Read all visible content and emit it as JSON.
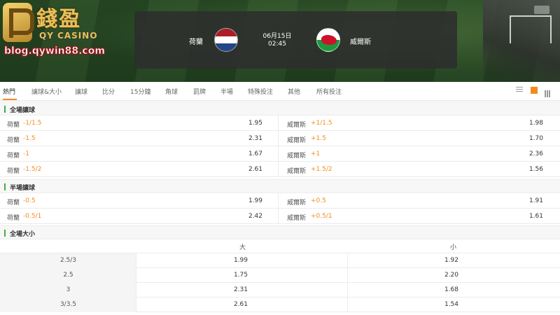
{
  "logo": {
    "brand_cn": "錢盈",
    "brand_en": "QY CASINO",
    "url": "blog.qywin88.com"
  },
  "match": {
    "home_team": "荷蘭",
    "away_team": "威爾斯",
    "date": "06月15日",
    "time": "02:45"
  },
  "tabs": [
    {
      "label": "熱門"
    },
    {
      "label": "讓球&大小"
    },
    {
      "label": "讓球"
    },
    {
      "label": "比分"
    },
    {
      "label": "15分鐘"
    },
    {
      "label": "角球"
    },
    {
      "label": "罰牌"
    },
    {
      "label": "半場"
    },
    {
      "label": "特殊投注"
    },
    {
      "label": "其他"
    },
    {
      "label": "所有投注"
    }
  ],
  "sections": {
    "full_handicap": {
      "title": "全場讓球",
      "rows": [
        {
          "home": "荷蘭",
          "home_hcp": "-1/1.5",
          "home_odds": "1.95",
          "away": "威爾斯",
          "away_hcp": "+1/1.5",
          "away_odds": "1.98"
        },
        {
          "home": "荷蘭",
          "home_hcp": "-1.5",
          "home_odds": "2.31",
          "away": "威爾斯",
          "away_hcp": "+1.5",
          "away_odds": "1.70"
        },
        {
          "home": "荷蘭",
          "home_hcp": "-1",
          "home_odds": "1.67",
          "away": "威爾斯",
          "away_hcp": "+1",
          "away_odds": "2.36"
        },
        {
          "home": "荷蘭",
          "home_hcp": "-1.5/2",
          "home_odds": "2.61",
          "away": "威爾斯",
          "away_hcp": "+1.5/2",
          "away_odds": "1.56"
        }
      ]
    },
    "half_handicap": {
      "title": "半場讓球",
      "rows": [
        {
          "home": "荷蘭",
          "home_hcp": "-0.5",
          "home_odds": "1.99",
          "away": "威爾斯",
          "away_hcp": "+0.5",
          "away_odds": "1.91"
        },
        {
          "home": "荷蘭",
          "home_hcp": "-0.5/1",
          "home_odds": "2.42",
          "away": "威爾斯",
          "away_hcp": "+0.5/1",
          "away_odds": "1.61"
        }
      ]
    },
    "full_ou": {
      "title": "全場大小",
      "over_label": "大",
      "under_label": "小",
      "rows": [
        {
          "line": "2.5/3",
          "over": "1.99",
          "under": "1.92"
        },
        {
          "line": "2.5",
          "over": "1.75",
          "under": "2.20"
        },
        {
          "line": "3",
          "over": "2.31",
          "under": "1.68"
        },
        {
          "line": "3/3.5",
          "over": "2.61",
          "under": "1.54"
        }
      ]
    }
  },
  "colors": {
    "accent": "#f28b1f",
    "section_marker": "#3cb043"
  },
  "icons": {
    "list_view": "list-icon",
    "single_view": "square-icon",
    "grid_view": "grid-icon"
  }
}
